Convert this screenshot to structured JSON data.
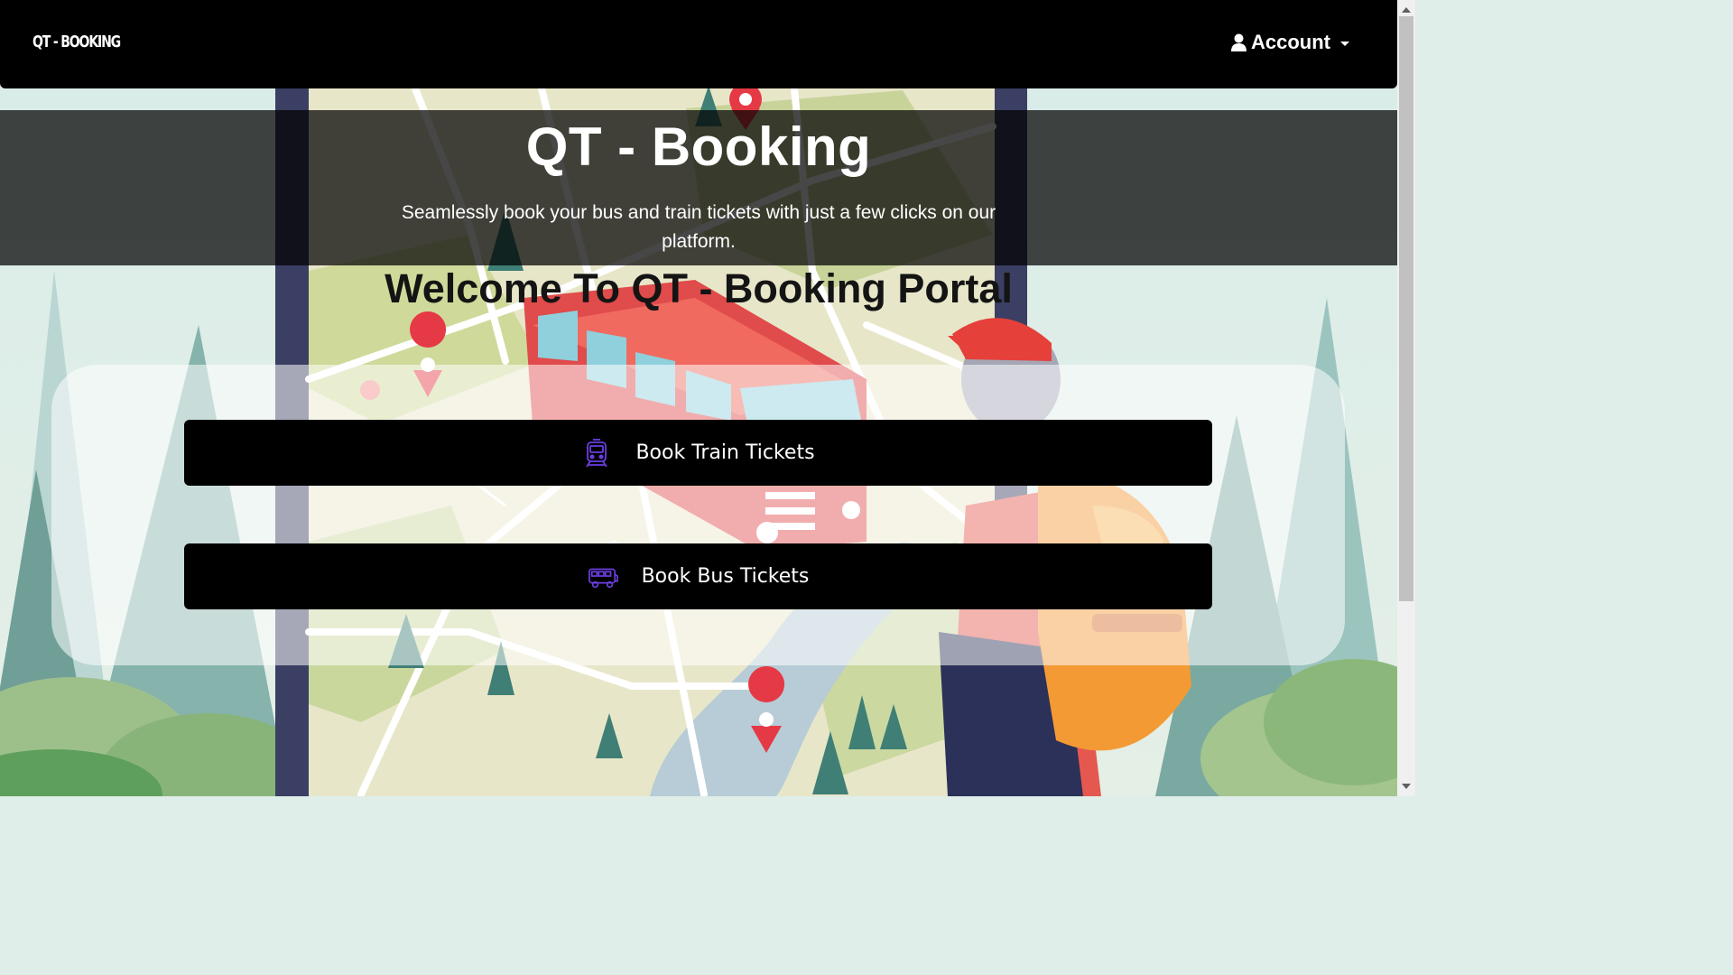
{
  "navbar": {
    "brand": "QT - BOOKING",
    "account_label": "Account"
  },
  "hero": {
    "title": "QT - Booking",
    "subtitle": "Seamlessly book your bus and train tickets with just a few clicks on our platform."
  },
  "welcome_heading": "Welcome To QT - Booking Portal",
  "actions": {
    "train": {
      "label": "Book Train Tickets",
      "icon": "train-icon"
    },
    "bus": {
      "label": "Book Bus Tickets",
      "icon": "bus-icon"
    }
  },
  "colors": {
    "navbar_bg": "#000000",
    "button_bg": "#000000",
    "icon_accent": "#6a3fe0"
  }
}
